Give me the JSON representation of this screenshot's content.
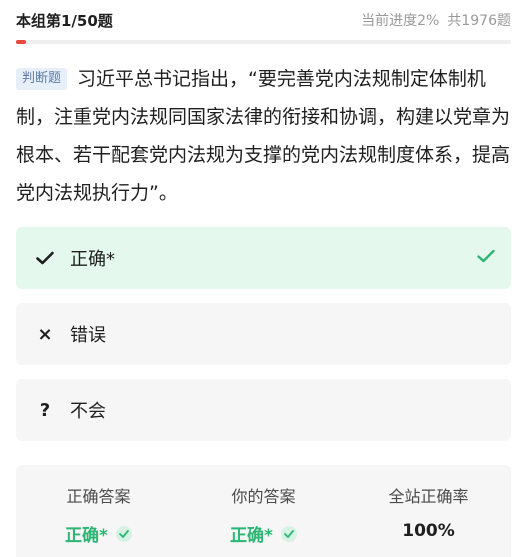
{
  "header": {
    "group_progress": "本组第1/50题",
    "current_progress": "当前进度2%",
    "total": "共1976题",
    "progress_fraction": 0.02
  },
  "question": {
    "type_tag": "判断题",
    "text": "习近平总书记指出，“要完善党内法规制定体制机制，注重党内法规同国家法律的衔接和协调，构建以党章为根本、若干配套党内法规为支撑的党内法规制度体系，提高党内法规执行力”。"
  },
  "options": [
    {
      "mark": "check",
      "label": "正确*",
      "state": "correct"
    },
    {
      "mark": "×",
      "label": "错误",
      "state": "normal"
    },
    {
      "mark": "?",
      "label": "不会",
      "state": "normal"
    }
  ],
  "stats": {
    "correct_answer_title": "正确答案",
    "correct_answer_value": "正确*",
    "your_answer_title": "你的答案",
    "your_answer_value": "正确*",
    "site_rate_title": "全站正确率",
    "site_rate_value": "100%"
  },
  "colors": {
    "accent_red": "#e8463e",
    "correct_green": "#2bb673",
    "correct_bg": "#e4f8ed",
    "tag_bg": "#e6effa"
  }
}
